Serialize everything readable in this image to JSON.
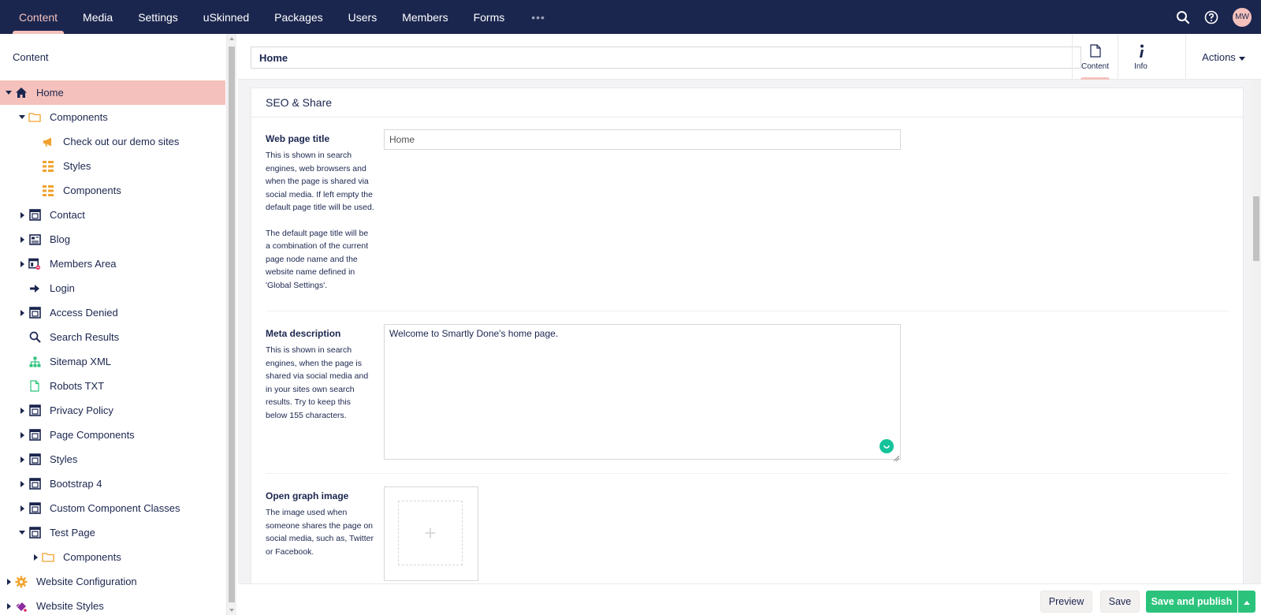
{
  "topbar": {
    "nav": [
      "Content",
      "Media",
      "Settings",
      "uSkinned",
      "Packages",
      "Users",
      "Members",
      "Forms"
    ],
    "more": "•••",
    "avatar_initials": "MW",
    "bg_color": "#1b264f",
    "accent_color": "#f5c1bc"
  },
  "sidebar": {
    "title": "Content",
    "tree": [
      {
        "label": "Home",
        "icon": "home-icon",
        "caret": "down",
        "level": 0,
        "selected": true
      },
      {
        "label": "Components",
        "icon": "folder-icon",
        "caret": "down",
        "level": 1
      },
      {
        "label": "Check out our demo sites",
        "icon": "megaphone-icon",
        "caret": "none",
        "level": 2
      },
      {
        "label": "Styles",
        "icon": "grid-list-icon",
        "caret": "none",
        "level": 2
      },
      {
        "label": "Components",
        "icon": "grid-list-icon",
        "caret": "none",
        "level": 2
      },
      {
        "label": "Contact",
        "icon": "layout-icon",
        "caret": "right",
        "level": 1
      },
      {
        "label": "Blog",
        "icon": "newspaper-icon",
        "caret": "right",
        "level": 1
      },
      {
        "label": "Members Area",
        "icon": "layout-restricted-icon",
        "caret": "right",
        "level": 1
      },
      {
        "label": "Login",
        "icon": "arrow-right-icon",
        "caret": "none",
        "level": 1
      },
      {
        "label": "Access Denied",
        "icon": "layout-icon",
        "caret": "right",
        "level": 1
      },
      {
        "label": "Search Results",
        "icon": "search-icon",
        "caret": "none",
        "level": 1
      },
      {
        "label": "Sitemap XML",
        "icon": "sitemap-icon",
        "caret": "none",
        "level": 1
      },
      {
        "label": "Robots TXT",
        "icon": "document-icon",
        "caret": "none",
        "level": 1
      },
      {
        "label": "Privacy Policy",
        "icon": "layout-icon",
        "caret": "right",
        "level": 1
      },
      {
        "label": "Page Components",
        "icon": "layout-icon",
        "caret": "right",
        "level": 1
      },
      {
        "label": "Styles",
        "icon": "layout-icon",
        "caret": "right",
        "level": 1
      },
      {
        "label": "Bootstrap 4",
        "icon": "layout-icon",
        "caret": "right",
        "level": 1
      },
      {
        "label": "Custom Component Classes",
        "icon": "layout-icon",
        "caret": "right",
        "level": 1
      },
      {
        "label": "Test Page",
        "icon": "layout-icon",
        "caret": "down",
        "level": 1
      },
      {
        "label": "Components",
        "icon": "folder-icon",
        "caret": "right",
        "level": 2
      },
      {
        "label": "Website Configuration",
        "icon": "gear-icon",
        "caret": "right",
        "level": 0
      },
      {
        "label": "Website Styles",
        "icon": "paint-icon",
        "caret": "right",
        "level": 0
      }
    ]
  },
  "editor": {
    "node_name": "Home",
    "apps": [
      {
        "label": "Content",
        "icon": "document-icon",
        "active": true
      },
      {
        "label": "Info",
        "icon": "info-icon",
        "active": false
      }
    ],
    "actions_label": "Actions"
  },
  "group": {
    "title": "SEO & Share",
    "properties": {
      "web_title": {
        "label": "Web page title",
        "description": "This is shown in search engines, web browsers and when the page is shared via social media. If left empty the default page title will be used.",
        "description2": "The default page title will be a combination of the current page node name and the website name defined in 'Global Settings'.",
        "placeholder": "Home"
      },
      "meta_description": {
        "label": "Meta description",
        "description": "This is shown in search engines, when the page is shared via social media and in your sites own search results. Try to keep this below 155 characters.",
        "value": "Welcome to Smartly Done's home page."
      },
      "og_image": {
        "label": "Open graph image",
        "description": "The image used when someone shares the page on social media, such as, Twitter or Facebook.",
        "add_symbol": "+"
      }
    }
  },
  "footer": {
    "preview": "Preview",
    "save": "Save",
    "save_publish": "Save and publish",
    "publish_color": "#2bc37c"
  }
}
